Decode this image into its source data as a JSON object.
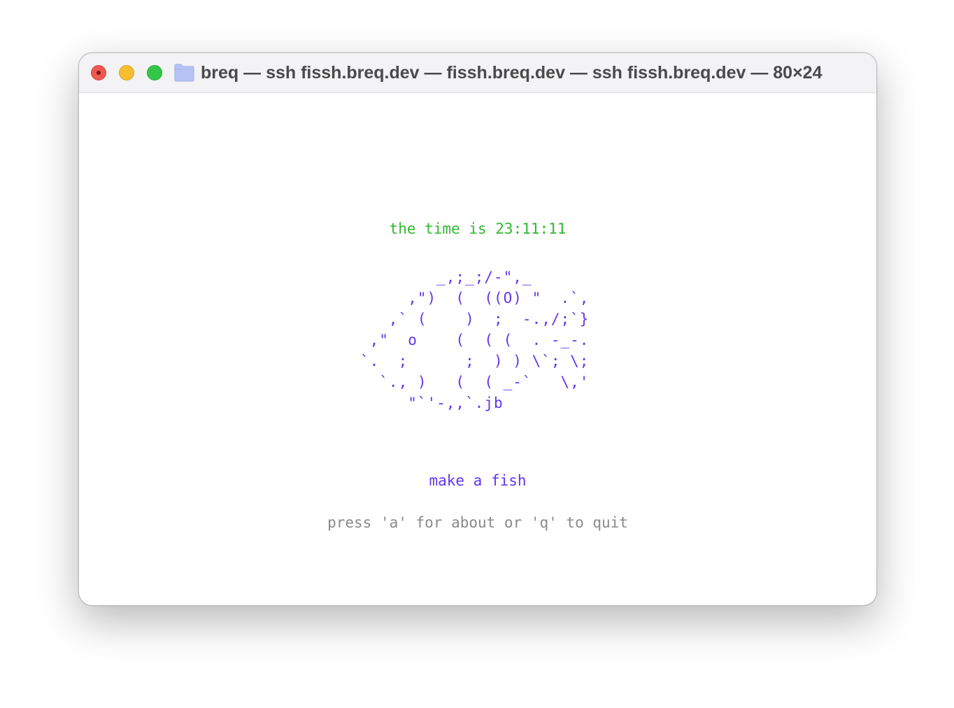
{
  "window": {
    "title": "breq — ssh fissh.breq.dev — fissh.breq.dev — ssh fissh.breq.dev — 80×24",
    "controls": [
      "close",
      "minimize",
      "zoom"
    ],
    "icon": "folder-icon"
  },
  "terminal": {
    "time_line": "the time is 23:11:11",
    "fish_art": "        _,;_;/-\",_\n     ,\")  (  ((O) \"  .`,\n   ,` (    )  ;  -.,/;`}\n ,\"  o    (  ( (  . -_-.\n`.  ;      ;  ) ) \\`; \\;\n  `., )   (  ( _-`   \\,'\n     \"`'-,,`.jb",
    "action": "make a fish",
    "hint": "press 'a' for about or 'q' to quit"
  },
  "colors": {
    "time": "#2fb82f",
    "fish": "#6236f0",
    "hint": "#8a8a8a"
  }
}
